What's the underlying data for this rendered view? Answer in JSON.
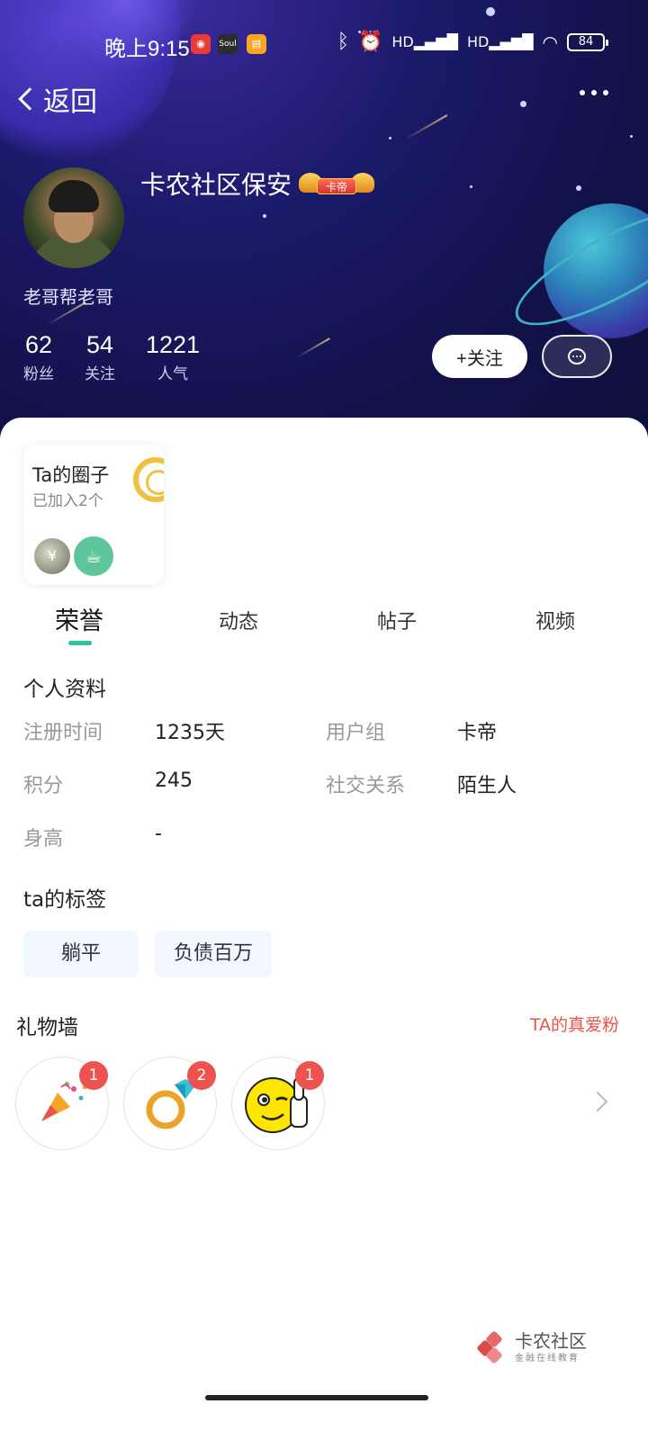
{
  "status_bar": {
    "time": "晚上9:15",
    "battery": "84"
  },
  "nav": {
    "back_label": "返回"
  },
  "profile": {
    "username": "卡农社区保安",
    "badge_label": "卡帝",
    "signature": "老哥帮老哥",
    "stats": [
      {
        "value": "62",
        "label": "粉丝"
      },
      {
        "value": "54",
        "label": "关注"
      },
      {
        "value": "1221",
        "label": "人气"
      }
    ],
    "follow_label": "+关注"
  },
  "circle_card": {
    "title": "Ta的圈子",
    "subtitle": "已加入2个",
    "icon1_glyph": "¥"
  },
  "tabs": [
    {
      "label": "荣誉",
      "active": true
    },
    {
      "label": "动态",
      "active": false
    },
    {
      "label": "帖子",
      "active": false
    },
    {
      "label": "视频",
      "active": false
    }
  ],
  "profile_info": {
    "title": "个人资料",
    "rows": [
      {
        "label": "注册时间",
        "value": "1235天"
      },
      {
        "label": "用户组",
        "value": "卡帝"
      },
      {
        "label": "积分",
        "value": "245"
      },
      {
        "label": "社交关系",
        "value": "陌生人"
      },
      {
        "label": "身高",
        "value": "-"
      }
    ]
  },
  "tags": {
    "title": "ta的标签",
    "items": [
      "躺平",
      "负债百万"
    ]
  },
  "gift_wall": {
    "title": "礼物墙",
    "fans_link": "TA的真爱粉",
    "gifts": [
      {
        "icon": "party-popper-icon",
        "count": "1"
      },
      {
        "icon": "diamond-ring-icon",
        "count": "2"
      },
      {
        "icon": "thumbs-up-emoji-icon",
        "count": "1"
      }
    ]
  },
  "watermark": {
    "name": "卡农社区",
    "tagline": "金融在线教育"
  },
  "colors": {
    "accent": "#2cc3a4",
    "badge_red": "#ef5350",
    "link_red": "#e8534a",
    "hero_dark": "#12124a"
  }
}
